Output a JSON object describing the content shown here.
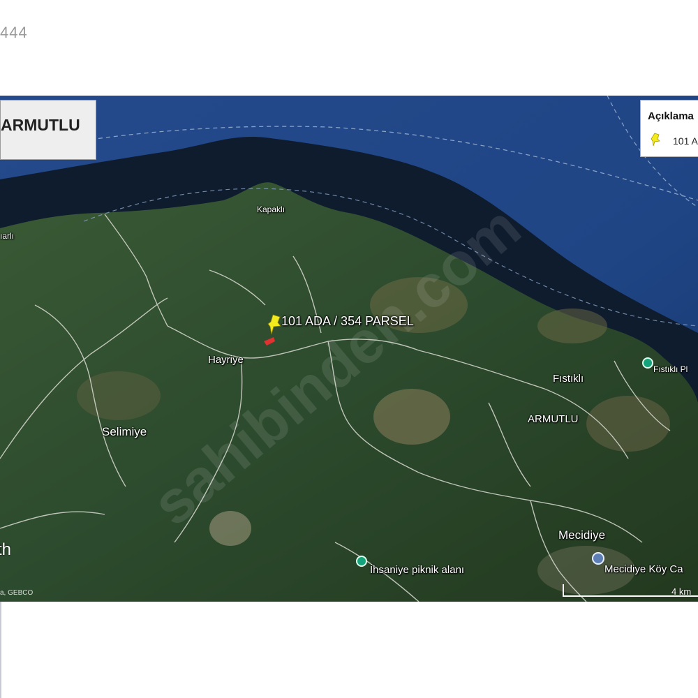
{
  "header": {
    "number_fragment": "444"
  },
  "map": {
    "title": "ARMUTLU",
    "legend": {
      "title": "Açıklama",
      "item_label": "101 A"
    },
    "parcel_label": "101 ADA / 354 PARSEL",
    "places": {
      "kapakli": "Kapaklı",
      "village_left": "ıarlı",
      "hayriye": "Hayriye",
      "selimiye": "Selimiye",
      "fistikli": "Fıstıklı",
      "armutlu": "ARMUTLU",
      "mecidiye": "Mecidiye",
      "insaniye": "İhsaniye piknik alanı",
      "mecidiye_koy": "Mecidiye Köy Ca",
      "fistikli_poi": "Fıstıklı Pl"
    },
    "watermark": "sahibinden.com",
    "brand": "th",
    "attribution": "a, GEBCO",
    "scale_label": "4 km"
  },
  "colors": {
    "sea": "#1d3f7c",
    "land_dark": "#27402a",
    "pin": "#f2ea1c",
    "parcel": "#e23131",
    "poi_green": "#14a37a",
    "poi_blue": "#5e7fb5"
  }
}
